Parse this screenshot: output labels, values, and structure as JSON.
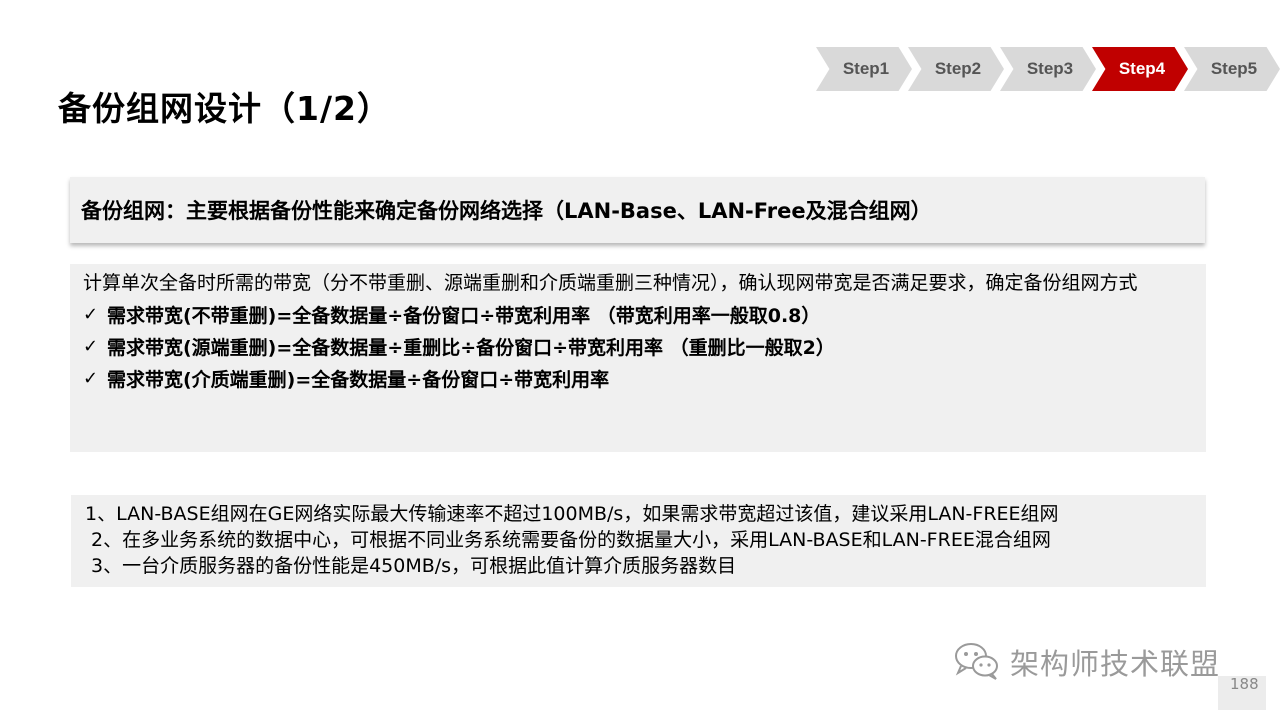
{
  "title": "备份组网设计（1/2）",
  "steps": [
    {
      "label": "Step1",
      "active": false
    },
    {
      "label": "Step2",
      "active": false
    },
    {
      "label": "Step3",
      "active": false
    },
    {
      "label": "Step4",
      "active": true
    },
    {
      "label": "Step5",
      "active": false
    }
  ],
  "banner": "备份组网：主要根据备份性能来确定备份网络选择（LAN-Base、LAN-Free及混合组网）",
  "panel": {
    "intro": "计算单次全备时所需的带宽（分不带重删、源端重删和介质端重删三种情况），确认现网带宽是否满足要求，确定备份组网方式",
    "checklist": [
      "需求带宽(不带重删)=全备数据量÷备份窗口÷带宽利用率 （带宽利用率一般取0.8）",
      "需求带宽(源端重删)=全备数据量÷重删比÷备份窗口÷带宽利用率 （重删比一般取2）",
      "需求带宽(介质端重删)=全备数据量÷备份窗口÷带宽利用率"
    ]
  },
  "notes": [
    "1、LAN-BASE组网在GE网络实际最大传输速率不超过100MB/s，如果需求带宽超过该值，建议采用LAN-FREE组网",
    "2、在多业务系统的数据中心，可根据不同业务系统需要备份的数据量大小，采用LAN-BASE和LAN-FREE混合组网",
    "3、一台介质服务器的备份性能是450MB/s，可根据此值计算介质服务器数目"
  ],
  "watermark": "架构师技术联盟",
  "page_number": "188",
  "colors": {
    "active_step": "#c00000",
    "inactive_step": "#d9d9d9",
    "panel_bg": "#f0f0f0"
  },
  "icons": {
    "check": "checkmark-icon",
    "watermark": "wechat-icon"
  }
}
